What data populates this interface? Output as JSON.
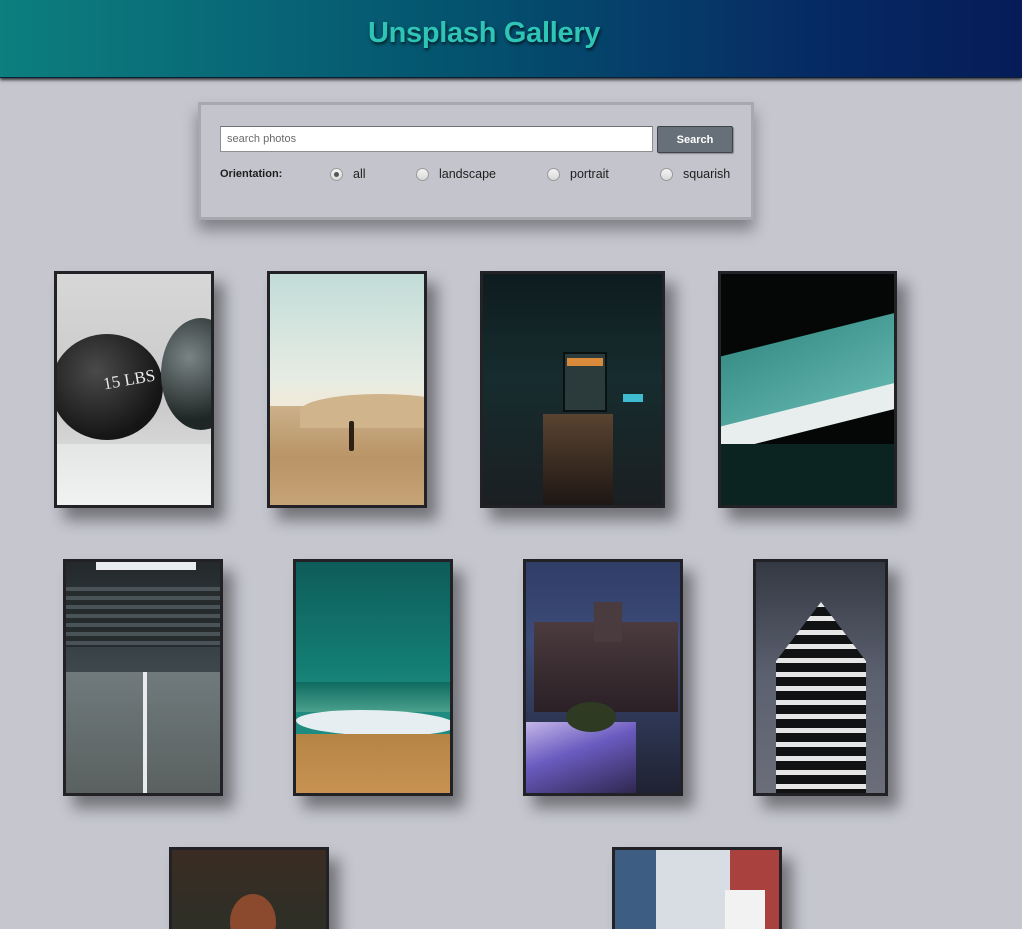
{
  "header": {
    "title": "Unsplash Gallery"
  },
  "search": {
    "placeholder": "search photos",
    "value": "",
    "button_label": "Search",
    "orientation_label": "Orientation:",
    "options": [
      {
        "label": "all",
        "checked": true
      },
      {
        "label": "landscape",
        "checked": false
      },
      {
        "label": "portrait",
        "checked": false
      },
      {
        "label": "squarish",
        "checked": false
      }
    ]
  },
  "gallery": {
    "photos": [
      {
        "subject": "medicine balls 15 lbs",
        "caption": "15 LBS"
      },
      {
        "subject": "person walking on desert dunes"
      },
      {
        "subject": "tram on city street at night"
      },
      {
        "subject": "teal architectural facade"
      },
      {
        "subject": "empty parking garage"
      },
      {
        "subject": "aerial ocean waves on beach"
      },
      {
        "subject": "city at night with light trails"
      },
      {
        "subject": "modern skyscraper balconies"
      },
      {
        "subject": "portrait among branches"
      },
      {
        "subject": "house and bare tree"
      }
    ]
  },
  "colors": {
    "background": "#c5c6ce",
    "title": "#2ec4b6",
    "header_start": "#0d7f7f",
    "header_end": "#061c58",
    "button": "#677079"
  }
}
